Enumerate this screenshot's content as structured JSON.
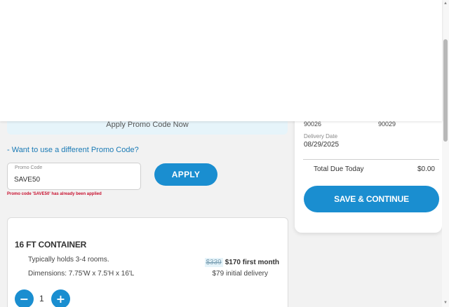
{
  "promo": {
    "banner_text": "Apply Promo Code Now",
    "different_code_link": "- Want to use a different Promo Code?",
    "field_label": "Promo Code",
    "field_value": "SAVE50",
    "apply_label": "APPLY",
    "error_text": "Promo code 'SAVE50' has already been applied"
  },
  "container": {
    "title": "16 FT CONTAINER",
    "description": "Typically holds 3-4 rooms.",
    "dimensions": "Dimensions: 7.75'W x 7.5'H x 16'L",
    "old_price": "$339",
    "new_price": "$170 first month",
    "delivery_fee": "$79 initial delivery",
    "quantity": "1",
    "minus_symbol": "−",
    "plus_symbol": "+"
  },
  "summary": {
    "zip_origin": "90026",
    "zip_destination": "90029",
    "delivery_date_label": "Delivery Date",
    "delivery_date": "08/29/2025",
    "total_label": "Total Due Today",
    "total_value": "$0.00",
    "save_label": "SAVE & CONTINUE"
  },
  "scrollbar": {
    "up_arrow": "▲",
    "down_arrow": "▼"
  },
  "colors": {
    "accent": "#1a8ed0",
    "banner_bg": "#e6f4fa",
    "error": "#c8102e",
    "link": "#1a7ab5"
  }
}
